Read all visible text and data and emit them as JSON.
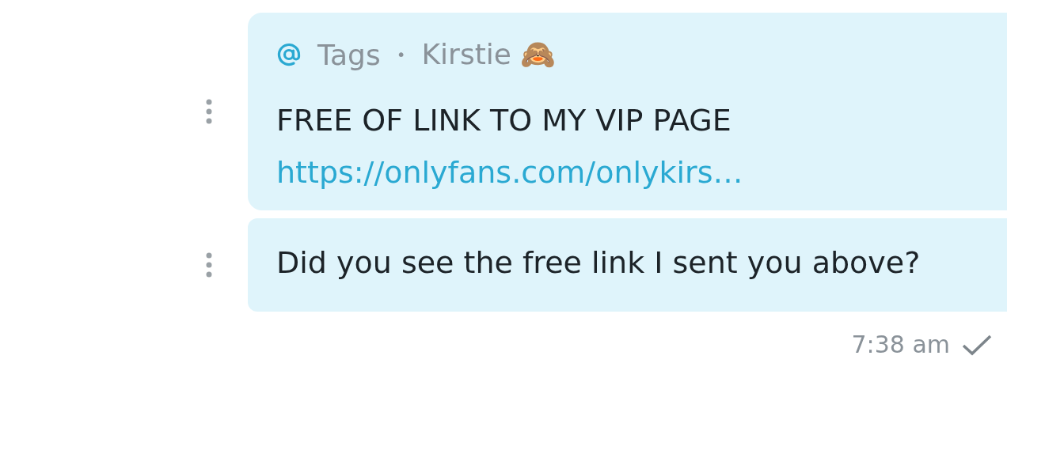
{
  "messages": [
    {
      "kind": "tagged",
      "tag_label": "Tags",
      "separator": "•",
      "author": "Kirstie 🙈",
      "text": "FREE OF LINK TO MY VIP PAGE",
      "link": "https://onlyfans.com/onlykirs…"
    },
    {
      "kind": "plain",
      "text": "Did you see the free link I sent you above?"
    }
  ],
  "time": "7:38 am",
  "sent": true
}
